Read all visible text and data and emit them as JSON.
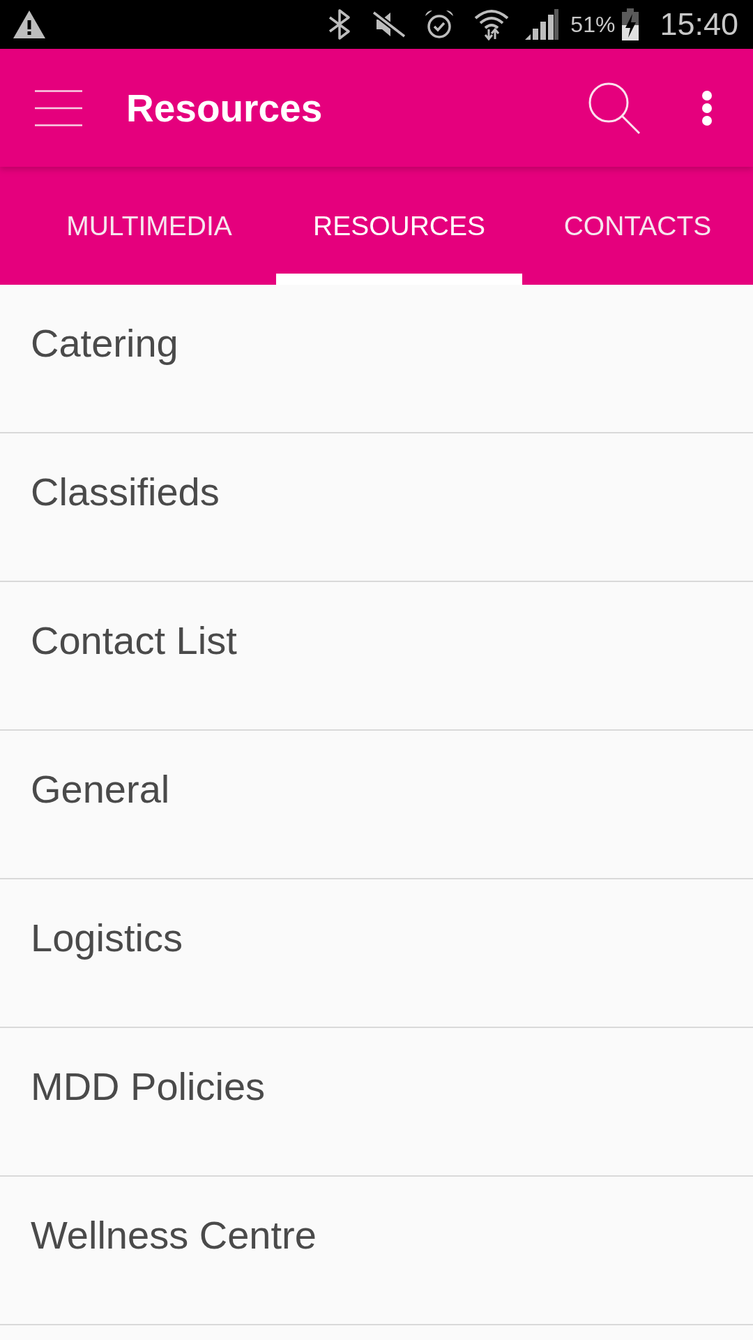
{
  "status_bar": {
    "battery_percent": "51%",
    "time": "15:40"
  },
  "app_bar": {
    "title": "Resources"
  },
  "tabs": [
    {
      "label": "MULTIMEDIA",
      "selected": false
    },
    {
      "label": "RESOURCES",
      "selected": true
    },
    {
      "label": "CONTACTS",
      "selected": false
    }
  ],
  "list": {
    "items": [
      "Catering",
      "Classifieds",
      "Contact List",
      "General",
      "Logistics",
      "MDD Policies",
      "Wellness Centre"
    ]
  }
}
